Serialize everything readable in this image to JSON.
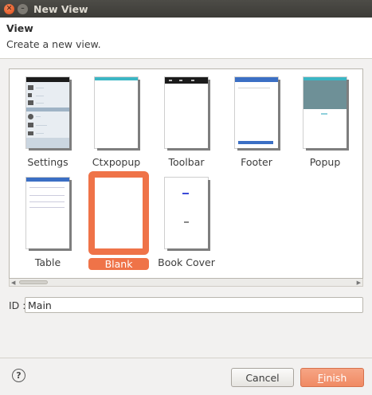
{
  "window": {
    "title": "New View"
  },
  "header": {
    "title": "View",
    "subtitle": "Create a new view."
  },
  "gallery": {
    "items": [
      {
        "label": "Settings"
      },
      {
        "label": "Ctxpopup"
      },
      {
        "label": "Toolbar"
      },
      {
        "label": "Footer"
      },
      {
        "label": "Popup"
      },
      {
        "label": "Table"
      },
      {
        "label": "Blank",
        "selected": true
      },
      {
        "label": "Book Cover"
      }
    ]
  },
  "form": {
    "id_label": "ID :",
    "id_value": "Main"
  },
  "buttons": {
    "help": "?",
    "cancel": "Cancel",
    "finish_mnemonic": "F",
    "finish_rest": "inish"
  },
  "colors": {
    "accent": "#ef7348",
    "titlebar": "#3c3b37"
  }
}
